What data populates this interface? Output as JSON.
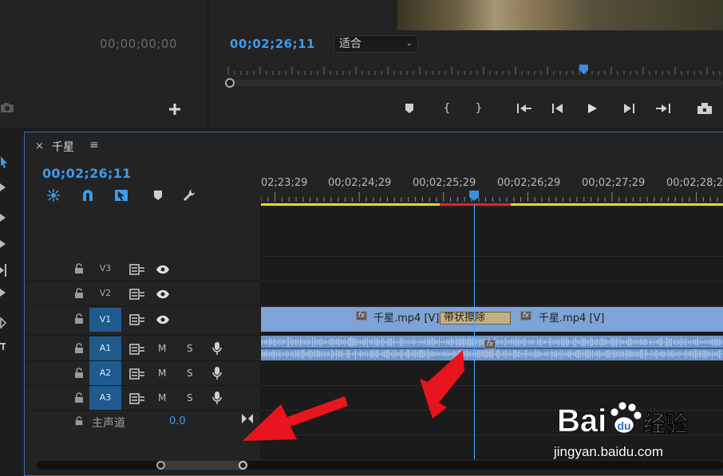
{
  "source_monitor": {
    "timecode": "00;00;00;00"
  },
  "program_monitor": {
    "timecode": "00;02;26;11",
    "fit_option": "适合",
    "transport_icons": [
      "marker-icon",
      "in-point-icon",
      "out-point-icon",
      "go-to-in-icon",
      "step-back-icon",
      "play-icon",
      "step-forward-icon",
      "go-to-out-icon",
      "export-frame-icon"
    ]
  },
  "timeline": {
    "sequence_name": "千星",
    "close_glyph": "×",
    "menu_glyph": "≡",
    "timecode": "00;02;26;11",
    "ruler_labels": [
      "02;23;29",
      "00;02;24;29",
      "00;02;25;29",
      "00;02;26;29",
      "00;02;27;29",
      "00;02;28;29"
    ],
    "tracks": [
      {
        "name": "V3",
        "kind": "video",
        "active": false
      },
      {
        "name": "V2",
        "kind": "video",
        "active": false
      },
      {
        "name": "V1",
        "kind": "video",
        "active": true
      },
      {
        "name": "A1",
        "kind": "audio",
        "active": true
      },
      {
        "name": "A2",
        "kind": "audio",
        "active": true
      },
      {
        "name": "A3",
        "kind": "audio",
        "active": true
      }
    ],
    "audio_buttons": {
      "mute": "M",
      "solo": "S"
    },
    "master": {
      "label": "主声道",
      "value": "0.0"
    },
    "clips": {
      "v1_left": "千星.mp4 [V]",
      "v1_right": "千星.mp4 [V]",
      "transition": "带状擦除",
      "fx_label": "fx"
    }
  },
  "watermark": {
    "logo_text": "Bai百度经验",
    "url": "jingyan.baidu.com"
  },
  "colors": {
    "accent": "#3d9bea",
    "clip_video": "#7ea3d6",
    "clip_audio": "#6f96c9",
    "work_area": "#e6dd1f",
    "render_red": "#e0262a",
    "arrow": "#e8141e"
  }
}
